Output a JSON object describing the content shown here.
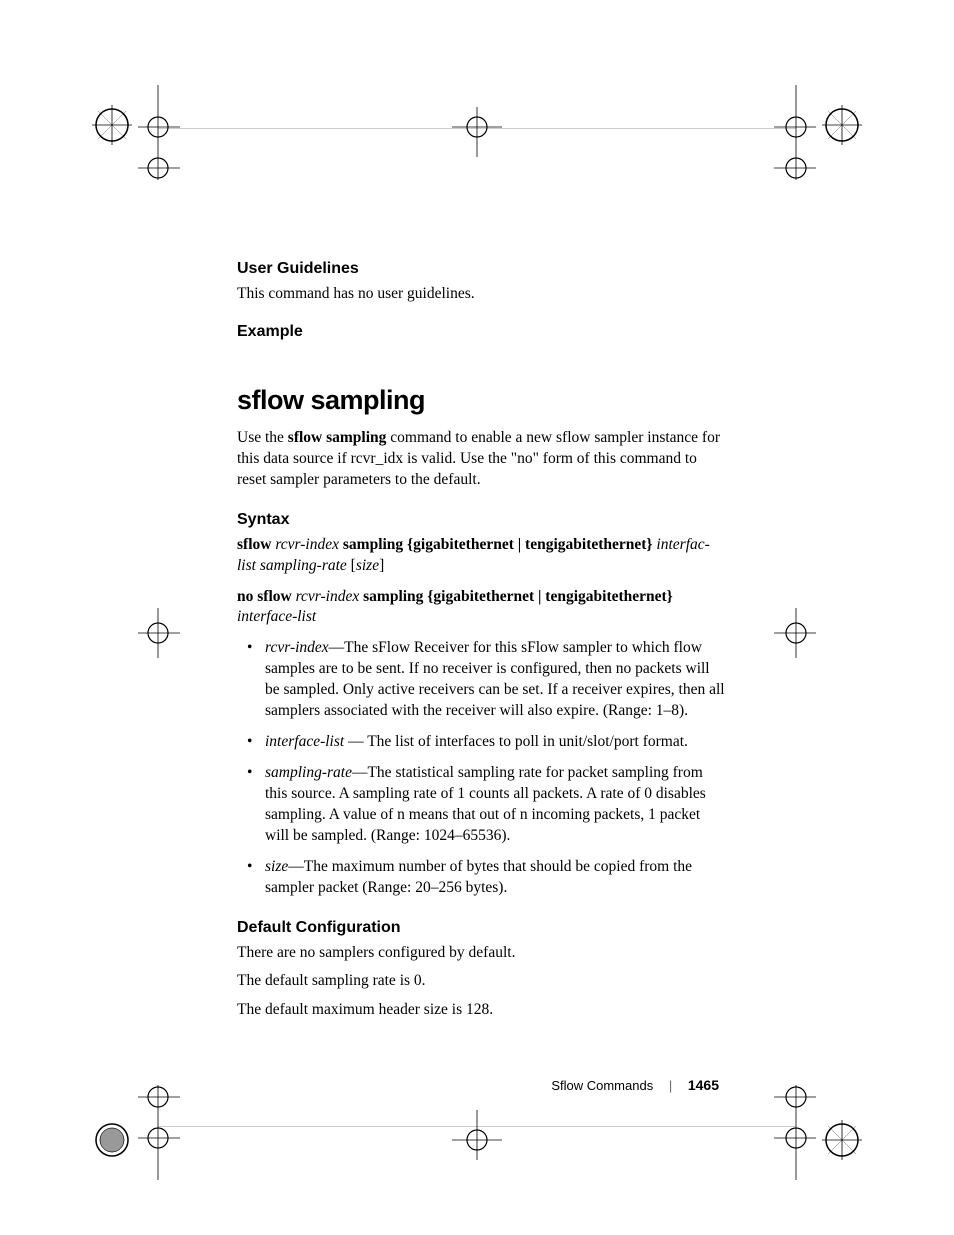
{
  "headings": {
    "user_guidelines": "User Guidelines",
    "example": "Example",
    "syntax": "Syntax",
    "default_config": "Default Configuration"
  },
  "user_guidelines_body": "This command has no user guidelines.",
  "section_title": "sflow sampling",
  "intro": {
    "pre": "Use the ",
    "cmd": "sflow sampling",
    "post": " command to enable a new sflow sampler instance for this data source if rcvr_idx is valid. Use the \"no\" form of this command to reset sampler parameters to the default."
  },
  "syntax1": {
    "p1": "sflow ",
    "p2": "rcvr-index",
    "p3": " sampling {gigabitethernet | tengigabitethernet} ",
    "p4": "interfac-list sampling-rate",
    "p5": " [",
    "p6": "size",
    "p7": "]"
  },
  "syntax2": {
    "p1": "no sflow ",
    "p2": "rcvr-index",
    "p3": " sampling {gigabitethernet | tengigabitethernet} ",
    "p4": "interface-list"
  },
  "bullets": [
    {
      "term": "rcvr-index",
      "dash": "—",
      "desc": "The sFlow Receiver for this sFlow sampler to which flow samples are to be sent.  If no receiver is configured, then no packets will be sampled.  Only active receivers can be set.  If a receiver expires, then all samplers associated with the receiver will also expire.  (Range: 1–8)."
    },
    {
      "term": "interface-list",
      "dash": " — ",
      "desc": "The list of interfaces to poll in unit/slot/port format."
    },
    {
      "term": "sampling-rate",
      "dash": "—",
      "desc": "The statistical sampling rate for packet sampling from this source.  A sampling rate of 1 counts all packets.  A rate of 0 disables sampling.  A value of n means that out of n incoming packets, 1 packet will be sampled.  (Range: 1024–65536)."
    },
    {
      "term": "size",
      "dash": "—",
      "desc": "The maximum number of bytes that should be copied from the sampler packet (Range: 20–256 bytes)."
    }
  ],
  "default_config_body": [
    "There are no samplers configured by default.",
    "The default sampling rate is 0.",
    "The default maximum header size is 128."
  ],
  "footer": {
    "chapter": "Sflow Commands",
    "page": "1465"
  }
}
